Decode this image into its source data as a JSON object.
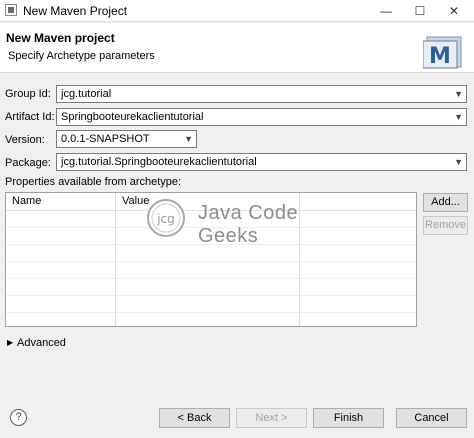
{
  "window": {
    "title": "New Maven Project",
    "minimize": "—",
    "maximize": "☐",
    "close": "✕"
  },
  "header": {
    "title": "New Maven project",
    "subtitle": "Specify Archetype parameters",
    "logo_letter": "M"
  },
  "form": {
    "group_id": {
      "label": "Group Id:",
      "value": "jcg.tutorial"
    },
    "artifact_id": {
      "label": "Artifact Id:",
      "value": "Springbooteurekaclientutorial"
    },
    "version": {
      "label": "Version:",
      "value": "0.0.1-SNAPSHOT"
    },
    "package": {
      "label": "Package:",
      "value": "jcg.tutorial.Springbooteurekaclientutorial"
    }
  },
  "properties": {
    "label": "Properties available from archetype:",
    "columns": [
      "Name",
      "Value"
    ],
    "add_label": "Add...",
    "remove_label": "Remove"
  },
  "watermark": {
    "badge": "jcg",
    "text": "Java Code Geeks"
  },
  "advanced": {
    "label": "Advanced"
  },
  "buttons": {
    "help": "?",
    "back": "< Back",
    "next": "Next >",
    "finish": "Finish",
    "cancel": "Cancel"
  },
  "colors": {
    "background": "#f0f0f0",
    "button": "#e1e1e1",
    "disabled_text": "#a0a0a0"
  }
}
